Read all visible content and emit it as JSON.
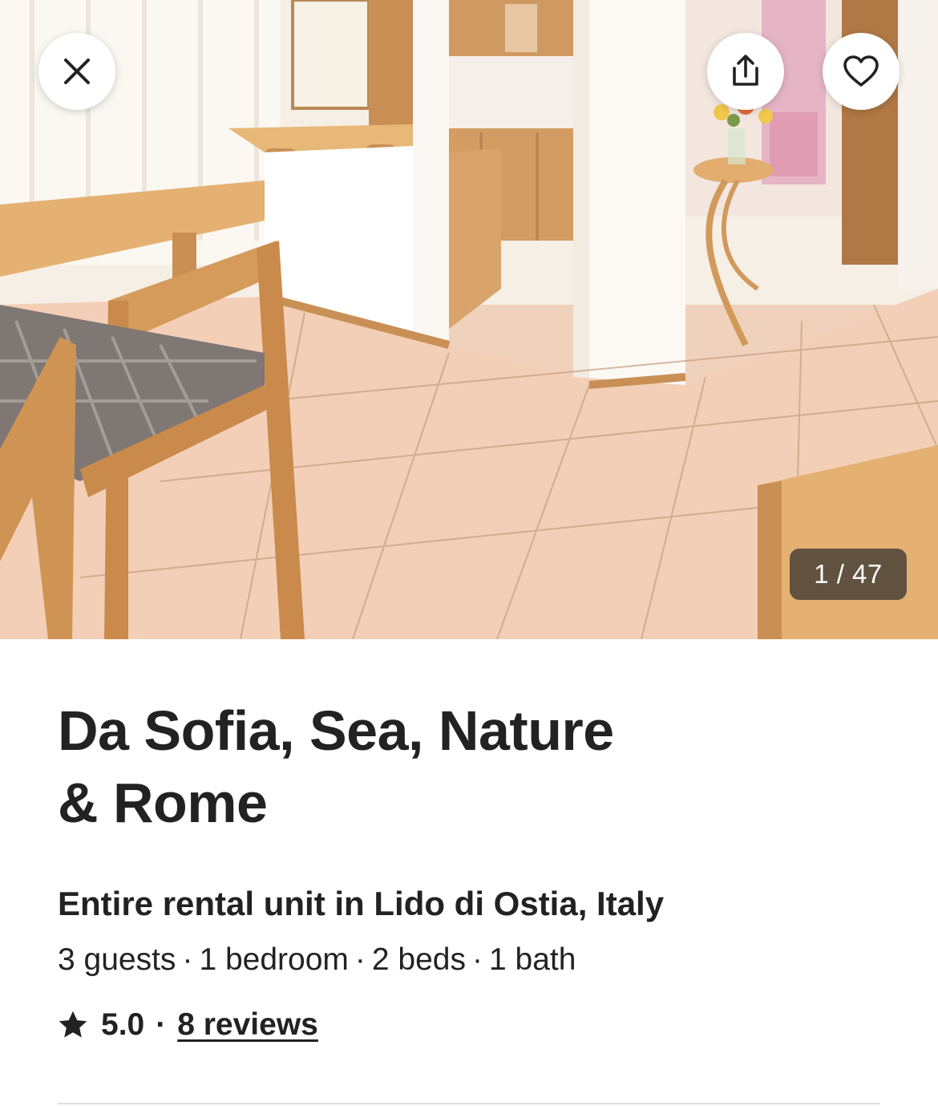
{
  "photo": {
    "alt": "",
    "counter": "1 / 47"
  },
  "actions": {
    "close_icon": "close-icon",
    "share_icon": "share-icon",
    "save_icon": "heart-icon"
  },
  "listing": {
    "title_line1": "Da Sofia, Sea, Nature",
    "title_line2": "& Rome",
    "subtitle": "Entire rental unit in Lido di Ostia, Italy",
    "specs": [
      "3 guests",
      "1 bedroom",
      "2 beds",
      "1 bath"
    ],
    "spec_separator": "·",
    "rating": "5.0",
    "rating_separator": "·",
    "reviews": "8 reviews"
  },
  "colors": {
    "text": "#222222",
    "divider": "#dddddd",
    "counter_bg": "#3c3732"
  }
}
